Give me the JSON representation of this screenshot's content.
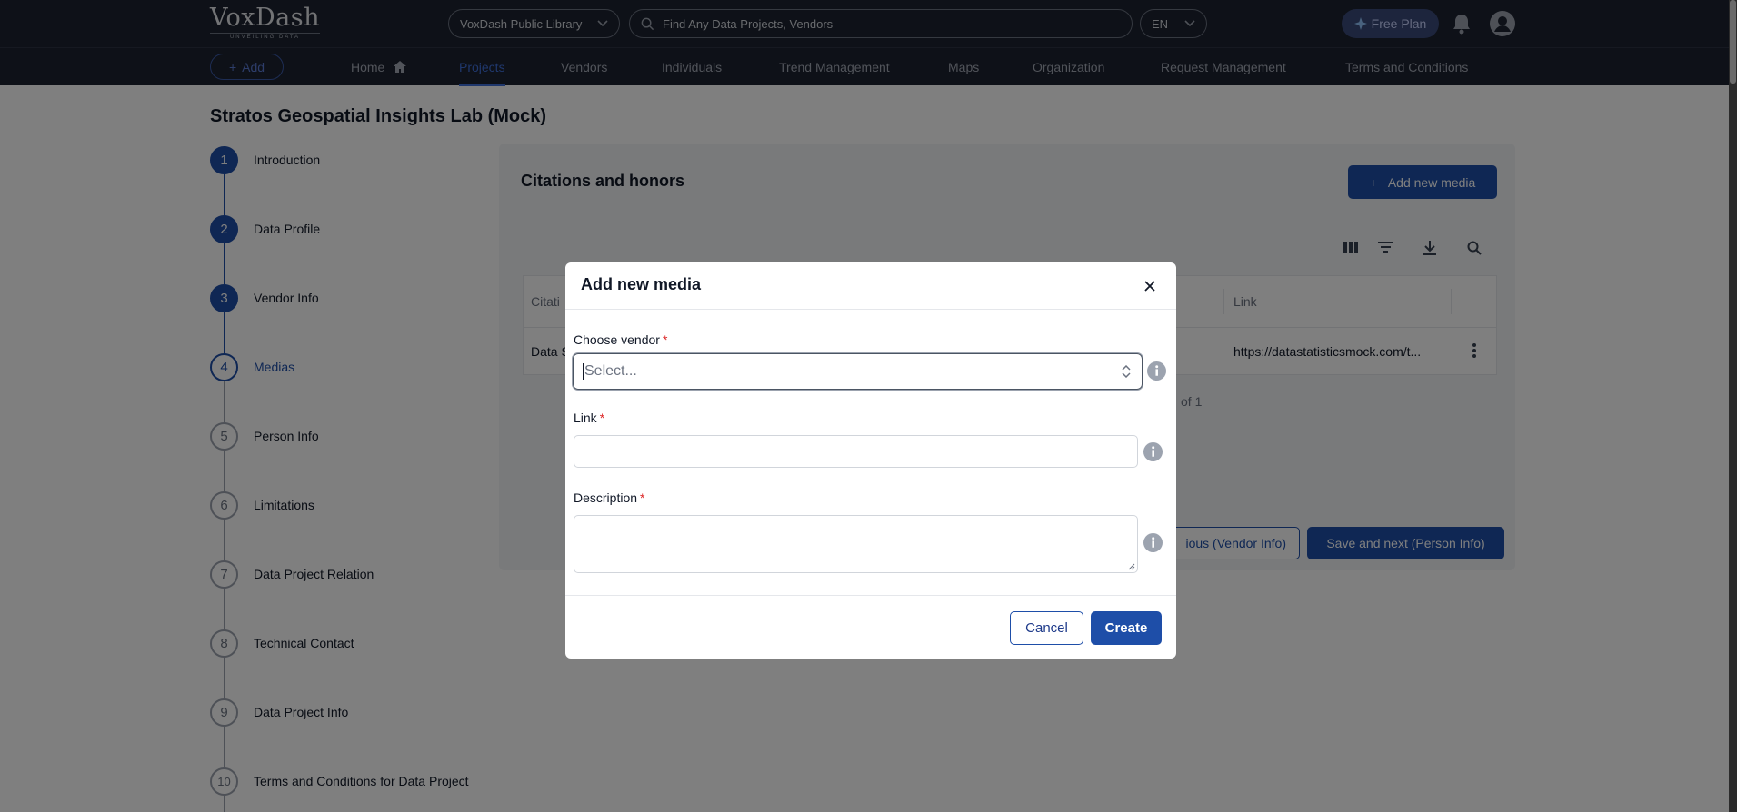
{
  "header": {
    "logo_text": "VoxDash",
    "logo_tagline": "UNVEILING DATA",
    "library_select": "VoxDash Public Library",
    "search_placeholder": "Find Any Data Projects, Vendors",
    "language": "EN",
    "free_plan_label": "Free Plan"
  },
  "nav": {
    "add_label": "Add",
    "items": [
      "Home",
      "Projects",
      "Vendors",
      "Individuals",
      "Trend Management",
      "Maps",
      "Organization",
      "Request Management",
      "Terms and Conditions"
    ],
    "active": "Projects"
  },
  "page": {
    "title": "Stratos Geospatial Insights Lab (Mock)"
  },
  "steps": [
    {
      "number": "1",
      "label": "Introduction",
      "state": "done"
    },
    {
      "number": "2",
      "label": "Data Profile",
      "state": "done"
    },
    {
      "number": "3",
      "label": "Vendor Info",
      "state": "done"
    },
    {
      "number": "4",
      "label": "Medias",
      "state": "current"
    },
    {
      "number": "5",
      "label": "Person Info",
      "state": "todo"
    },
    {
      "number": "6",
      "label": "Limitations",
      "state": "todo"
    },
    {
      "number": "7",
      "label": "Data Project Relation",
      "state": "todo"
    },
    {
      "number": "8",
      "label": "Technical Contact",
      "state": "todo"
    },
    {
      "number": "9",
      "label": "Data Project Info",
      "state": "todo"
    },
    {
      "number": "10",
      "label": "Terms and Conditions for Data Project",
      "state": "todo"
    }
  ],
  "section": {
    "title": "Citations and honors",
    "add_button_label": "Add new media",
    "table": {
      "col_citation": "Citati",
      "col_link": "Link",
      "row_citation": "Data S",
      "row_link": "https://datastatisticsmock.com/t..."
    },
    "pager_text": "of 1",
    "prev_button_label": "ious (Vendor Info)",
    "next_button_label": "Save and next (Person Info)"
  },
  "modal": {
    "title": "Add new media",
    "vendor_label": "Choose vendor",
    "vendor_placeholder": "Select...",
    "link_label": "Link",
    "description_label": "Description",
    "required_mark": "*",
    "cancel_label": "Cancel",
    "create_label": "Create"
  },
  "colors": {
    "primary": "#1e4ea8",
    "topbar": "#1c2230",
    "required": "#dc2626"
  }
}
